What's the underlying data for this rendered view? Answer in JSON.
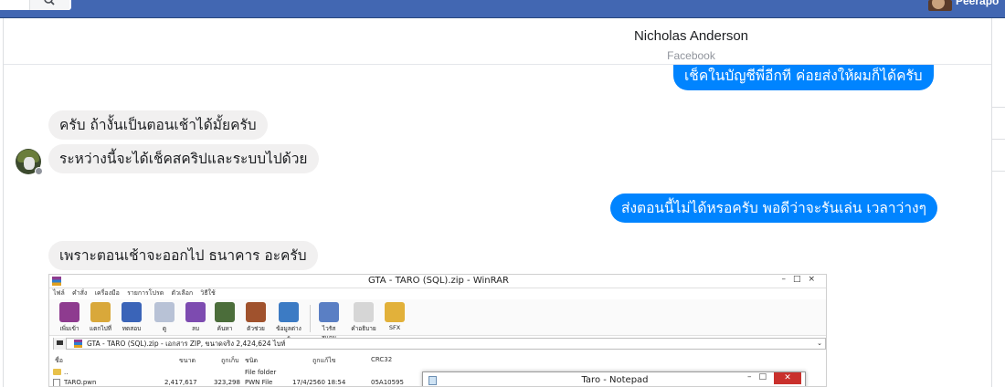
{
  "topbar": {
    "user_name": "Peerapo"
  },
  "conversation": {
    "contact_name": "Nicholas Anderson",
    "contact_subtitle": "Facebook"
  },
  "messages": [
    {
      "side": "outgoing",
      "text": "เช็คในบัญชีพี่อีกที ค่อยส่งให้ผมก็ได้ครับ"
    },
    {
      "side": "incoming",
      "text": "ครับ ถ้างั้นเป็นตอนเช้าได้มั้ยครับ"
    },
    {
      "side": "incoming",
      "text": "ระหว่างนี้จะได้เช็คสคริปและระบบไปด้วย"
    },
    {
      "side": "outgoing",
      "text": "ส่งตอนนี้ไม่ได้หรอครับ พอดีว่าจะรันเล่น เวลาว่างๆ"
    },
    {
      "side": "incoming",
      "text": "เพราะตอนเช้าจะออกไป ธนาคาร อะครับ"
    }
  ],
  "attachment": {
    "window_title": "GTA - TARO (SQL).zip - WinRAR",
    "menu": [
      "ไฟล์",
      "คำสั่ง",
      "เครื่องมือ",
      "รายการโปรด",
      "ตัวเลือก",
      "วิธีใช้"
    ],
    "toolbar": [
      {
        "label": "เพิ่มเข้า",
        "color": "#8e3b8f"
      },
      {
        "label": "แตกไปที่",
        "color": "#d9a83a"
      },
      {
        "label": "ทดสอบ",
        "color": "#3a64b8"
      },
      {
        "label": "ดู",
        "color": "#b8c2d6"
      },
      {
        "label": "ลบ",
        "color": "#7d4bb0"
      },
      {
        "label": "ค้นหา",
        "color": "#4b6d3a"
      },
      {
        "label": "ตัวช่วย",
        "color": "#a0522d"
      },
      {
        "label": "ข้อมูลต่าง ๆ",
        "color": "#3c7bc4"
      },
      {
        "label": "ไวรัสสแกน",
        "color": "#5a7fc4"
      },
      {
        "label": "คำอธิบาย",
        "color": "#d6d6d6"
      },
      {
        "label": "SFX",
        "color": "#e2b13a"
      }
    ],
    "address": "GTA - TARO (SQL).zip - เอกสาร ZIP, ขนาดจริง 2,424,624 ไบท์",
    "columns": [
      "ชื่อ",
      "ขนาด",
      "ถูกเก็บ",
      "ชนิด",
      "ถูกแก้ไข",
      "CRC32"
    ],
    "rows": [
      {
        "name": "..",
        "size": "",
        "packed": "",
        "type": "File folder",
        "modified": "",
        "crc": ""
      },
      {
        "name": "TARO.pwn",
        "size": "2,417,617",
        "packed": "323,298",
        "type": "PWN File",
        "modified": "17/4/2560 18:54",
        "crc": "05A10595"
      }
    ],
    "notepad_title": "Taro - Notepad"
  }
}
